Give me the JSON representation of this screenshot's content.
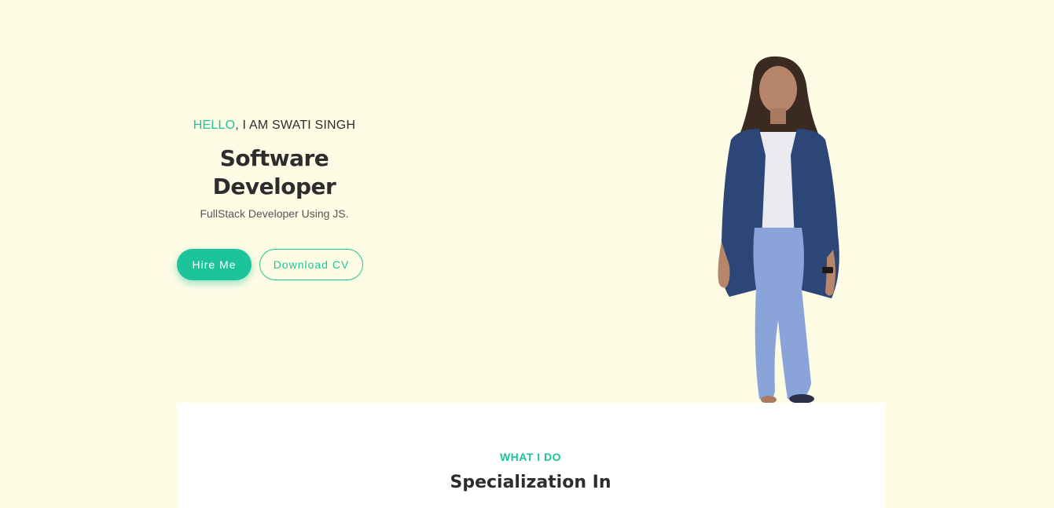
{
  "hero": {
    "greeting_hello": "HELLO",
    "greeting_rest": ", I AM SWATI SINGH",
    "title": "Software Developer",
    "subtitle": "FullStack Developer Using JS.",
    "hire_label": "Hire Me",
    "download_label": "Download CV"
  },
  "section": {
    "kicker": "WHAT I DO",
    "title": "Specialization In"
  },
  "colors": {
    "background": "#fffce6",
    "accent": "#1bc49b",
    "text": "#2d2d2d",
    "card": "#ffffff"
  }
}
